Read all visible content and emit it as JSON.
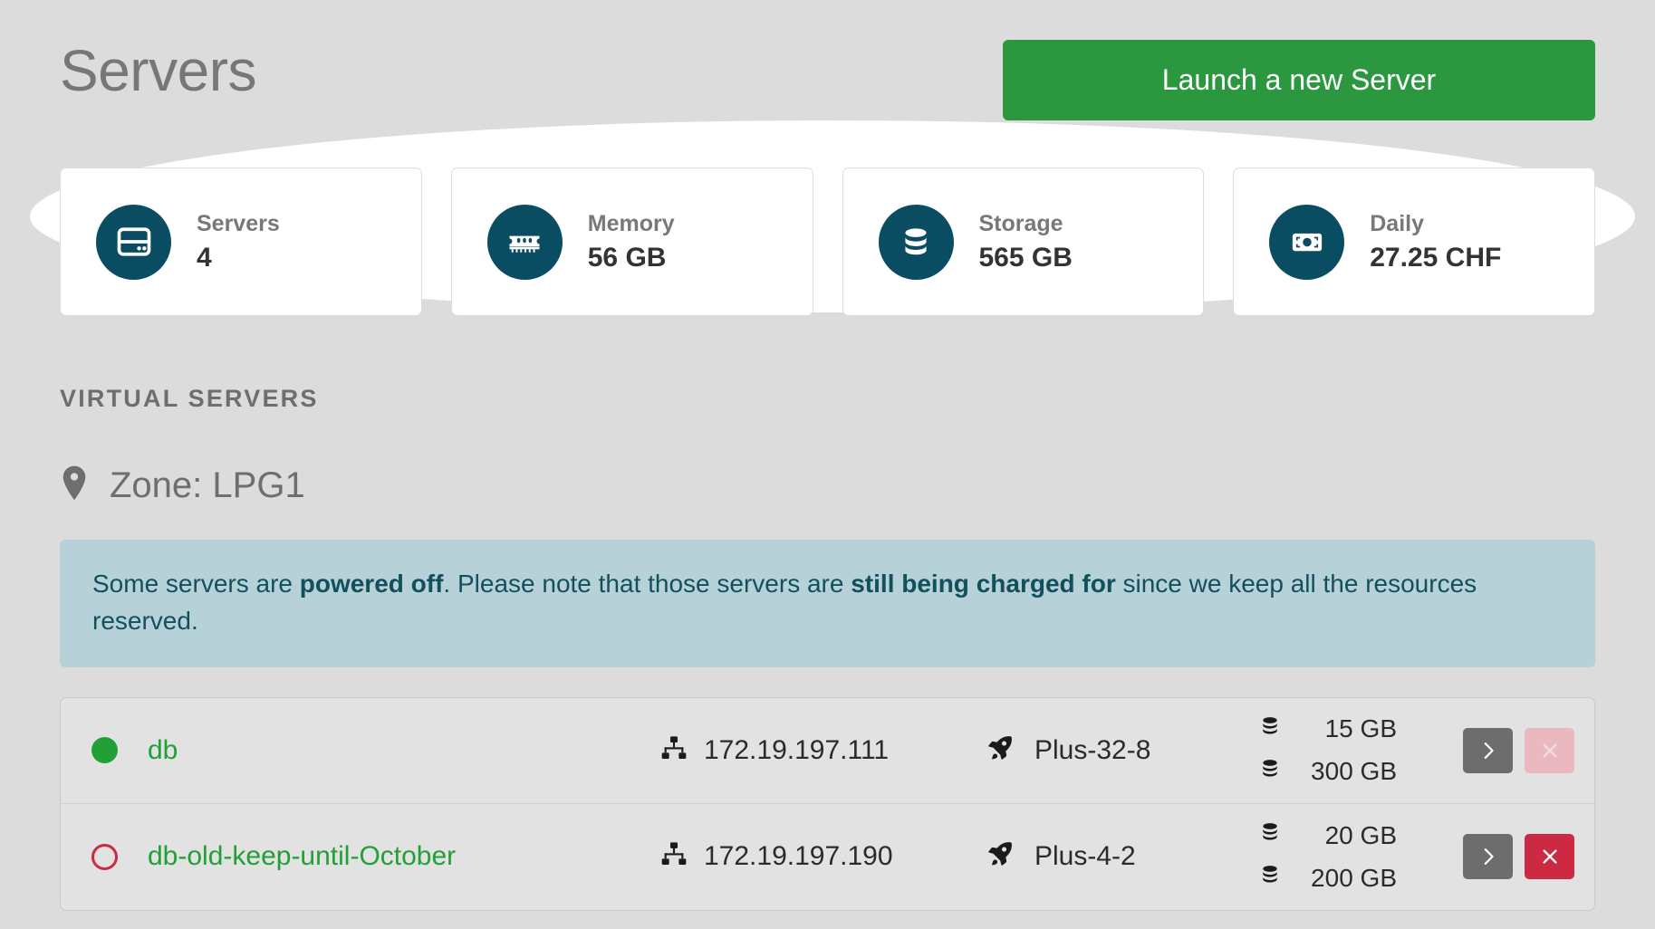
{
  "header": {
    "title": "Servers",
    "launch_button": "Launch a new Server"
  },
  "stats": [
    {
      "icon": "server-icon",
      "label": "Servers",
      "value": "4"
    },
    {
      "icon": "memory-icon",
      "label": "Memory",
      "value": "56 GB"
    },
    {
      "icon": "storage-icon",
      "label": "Storage",
      "value": "565 GB"
    },
    {
      "icon": "money-icon",
      "label": "Daily",
      "value": "27.25 CHF"
    }
  ],
  "section": {
    "heading": "VIRTUAL SERVERS",
    "zone_label": "Zone: LPG1",
    "zone_icon": "map-pin-icon"
  },
  "notice": {
    "part1": "Some servers are ",
    "bold1": "powered off",
    "part2": ". Please note that those servers are ",
    "bold2": "still being charged for",
    "part3": " since we keep all the resources reserved."
  },
  "servers": [
    {
      "status": "running",
      "status_color": "#21a038",
      "name": "db",
      "ip": "172.19.197.111",
      "plan": "Plus-32-8",
      "disks": [
        "15 GB",
        "300 GB"
      ],
      "go_label": "›",
      "delete_label": "×",
      "delete_enabled": false
    },
    {
      "status": "stopped",
      "status_color": "#cc2a43",
      "name": "db-old-keep-until-October",
      "ip": "172.19.197.190",
      "plan": "Plus-4-2",
      "disks": [
        "20 GB",
        "200 GB"
      ],
      "go_label": "›",
      "delete_label": "×",
      "delete_enabled": true
    }
  ],
  "colors": {
    "page_background": "#dcdcdc",
    "accent_green": "#2b9840",
    "icon_circle": "#0a4d63",
    "notice_background": "#b6d2d8",
    "notice_text": "#12505e",
    "danger_red": "#cc2a43"
  }
}
